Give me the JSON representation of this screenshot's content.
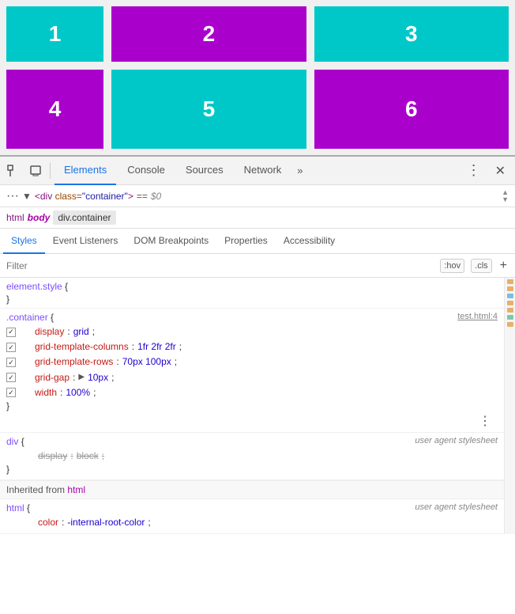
{
  "demo": {
    "cells": [
      {
        "label": "1",
        "color": "#00c8c8"
      },
      {
        "label": "2",
        "color": "#aa00cc"
      },
      {
        "label": "3",
        "color": "#00c8c8"
      },
      {
        "label": "4",
        "color": "#aa00cc"
      },
      {
        "label": "5",
        "color": "#00c8c8"
      },
      {
        "label": "6",
        "color": "#aa00cc"
      }
    ]
  },
  "devtools": {
    "toolbar": {
      "tabs": [
        "Elements",
        "Console",
        "Sources",
        "Network"
      ],
      "more_label": "»",
      "menu_icon": "⋮",
      "close_icon": "✕",
      "inspect_icon": "⬚",
      "device_icon": "□"
    },
    "breadcrumb": {
      "dots": "···",
      "arrow": "▼",
      "tag_open": "<div",
      "attr_class": " class=",
      "attr_val": "\"container\"",
      "eq": "==",
      "dollar": "$0",
      "tag_close": ">"
    },
    "crumb_path": {
      "html": "html",
      "body": "body",
      "div": "div.container"
    },
    "subtabs": {
      "tabs": [
        "Styles",
        "Event Listeners",
        "DOM Breakpoints",
        "Properties",
        "Accessibility"
      ]
    },
    "filter": {
      "placeholder": "Filter",
      "hov_btn": ":hov",
      "cls_btn": ".cls",
      "add_btn": "+"
    },
    "css_rules": [
      {
        "selector": "element.style",
        "brace_open": " {",
        "brace_close": "}",
        "source": "",
        "properties": []
      },
      {
        "selector": ".container",
        "brace_open": " {",
        "brace_close": "}",
        "source": "test.html:4",
        "properties": [
          {
            "name": "display",
            "value": "grid",
            "checked": true,
            "strikethrough": false
          },
          {
            "name": "grid-template-columns",
            "value": "1fr 2fr 2fr",
            "checked": true,
            "strikethrough": false
          },
          {
            "name": "grid-template-rows",
            "value": "70px 100px",
            "checked": true,
            "strikethrough": false
          },
          {
            "name": "grid-gap",
            "value": "10px",
            "checked": true,
            "strikethrough": false,
            "triangle": true
          },
          {
            "name": "width",
            "value": "100%",
            "checked": true,
            "strikethrough": false
          }
        ]
      },
      {
        "selector": "div",
        "brace_open": " {",
        "brace_close": "}",
        "source": "user agent stylesheet",
        "properties": [
          {
            "name": "display",
            "value": "block",
            "checked": false,
            "strikethrough": true
          }
        ]
      }
    ],
    "inherited_from": {
      "label": "Inherited from",
      "tag": "html"
    },
    "html_rule": {
      "selector": "html",
      "brace_open": " {",
      "source": "user agent stylesheet",
      "properties": [
        {
          "name": "color",
          "value": "-internal-root-color",
          "checked": false,
          "strikethrough": false
        }
      ]
    },
    "more_dots_label": "⋮",
    "gutter_marks": [
      {
        "color": "#e8b06a"
      },
      {
        "color": "#e8b06a"
      },
      {
        "color": "#79c0e0"
      },
      {
        "color": "#e8b06a"
      },
      {
        "color": "#e8b06a"
      },
      {
        "color": "#7ec8b0"
      },
      {
        "color": "#e8b06a"
      }
    ]
  }
}
